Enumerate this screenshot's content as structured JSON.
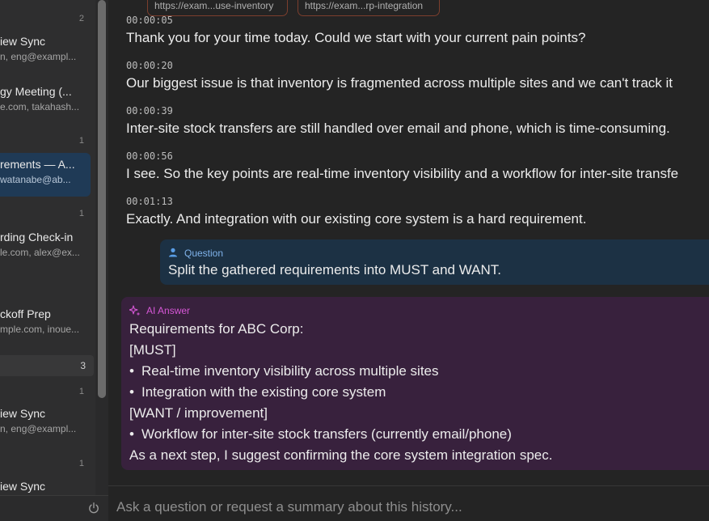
{
  "sidebar": {
    "items": [
      {
        "count": "2",
        "title": "iew Sync",
        "sub": "n, eng@exampl..."
      },
      {
        "count": "",
        "title": "gy Meeting (...",
        "sub": "e.com, takahash..."
      },
      {
        "count": "1",
        "title": "rements — A...",
        "sub": "watanabe@ab..."
      },
      {
        "count": "1",
        "title": "rding Check-in",
        "sub": "le.com, alex@ex..."
      },
      {
        "count": "",
        "title": "ckoff Prep",
        "sub": "mple.com, inoue..."
      },
      {
        "count": "1",
        "title": "iew Sync",
        "sub": "n, eng@exampl..."
      },
      {
        "count": "1",
        "title": "iew Sync",
        "sub": ""
      }
    ],
    "group_count": "3"
  },
  "links": [
    "https://exam...use-inventory",
    "https://exam...rp-integration"
  ],
  "transcript": [
    {
      "time": "00:00:05",
      "text": "Thank you for your time today. Could we start with your current pain points?"
    },
    {
      "time": "00:00:20",
      "text": "Our biggest issue is that inventory is fragmented across multiple sites and we can't track it"
    },
    {
      "time": "00:00:39",
      "text": "Inter-site stock transfers are still handled over email and phone, which is time-consuming."
    },
    {
      "time": "00:00:56",
      "text": "I see. So the key points are real-time inventory visibility and a workflow for inter-site transfe"
    },
    {
      "time": "00:01:13",
      "text": "Exactly. And integration with our existing core system is a hard requirement."
    }
  ],
  "question": {
    "label": "Question",
    "text": "Split the gathered requirements into MUST and WANT."
  },
  "answer": {
    "label": "AI Answer",
    "heading": "Requirements for ABC Corp:",
    "must_label": "[MUST]",
    "must": [
      "Real-time inventory visibility across multiple sites",
      "Integration with the existing core system"
    ],
    "want_label": "[WANT / improvement]",
    "want": [
      "Workflow for inter-site stock transfers (currently email/phone)"
    ],
    "closing": "As a next step, I suggest confirming the core system integration spec."
  },
  "input": {
    "placeholder": "Ask a question or request a summary about this history..."
  },
  "colors": {
    "question_bg": "#1c3144",
    "answer_bg": "#38213d",
    "answer_accent": "#d657d6",
    "question_accent": "#7fb2ea",
    "link_border": "#7c3e2d"
  }
}
